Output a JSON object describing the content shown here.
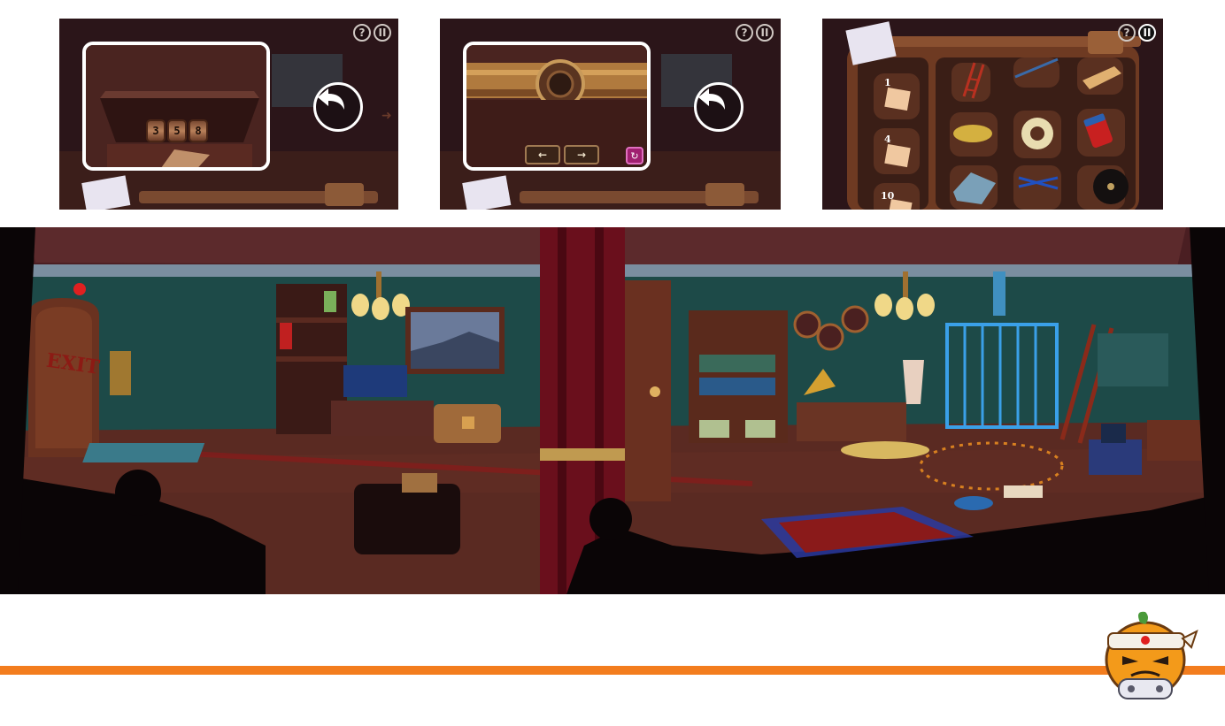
{
  "thumbnails": {
    "lock": {
      "digits": [
        "3",
        "5",
        "8"
      ],
      "hud": {
        "help": "?",
        "pause": "II"
      }
    },
    "dial": {
      "left_arrow": "←",
      "right_arrow": "→",
      "reset": "↻",
      "hud": {
        "help": "?",
        "pause": "II"
      }
    },
    "inventory": {
      "counts": [
        "1",
        "4",
        "10"
      ],
      "items": [
        "paper-note",
        "ladder",
        "crowbar",
        "cheese",
        "plank",
        "tape-roll",
        "battery",
        "cloth",
        "scissors",
        "vinyl-record"
      ],
      "hud": {
        "help": "?",
        "pause": "II"
      }
    }
  },
  "scene": {
    "exit_sign": "EXIT"
  },
  "colors": {
    "brand_orange": "#f37d1e",
    "wall_teal": "#1d4a48",
    "floor_wood": "#5a2a22",
    "curtain_red": "#6a0f1c"
  }
}
